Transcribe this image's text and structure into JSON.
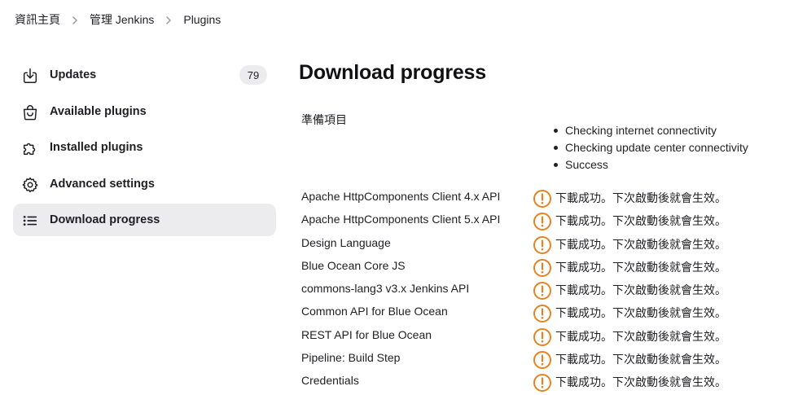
{
  "breadcrumb": {
    "items": [
      "資訊主頁",
      "管理 Jenkins",
      "Plugins"
    ]
  },
  "sidebar": {
    "items": [
      {
        "label": "Updates",
        "icon": "download-icon",
        "badge": "79"
      },
      {
        "label": "Available plugins",
        "icon": "shopping-bag-icon"
      },
      {
        "label": "Installed plugins",
        "icon": "puzzle-icon"
      },
      {
        "label": "Advanced settings",
        "icon": "gear-icon"
      },
      {
        "label": "Download progress",
        "icon": "list-icon",
        "active": true
      }
    ]
  },
  "main": {
    "title": "Download progress",
    "preparation": {
      "label": "準備項目",
      "checks": [
        "Checking internet connectivity",
        "Checking update center connectivity",
        "Success"
      ]
    },
    "status_icon": "warning-circle-icon",
    "status_color": "#e8821e",
    "plugins": [
      {
        "name": "Apache HttpComponents Client 4.x API",
        "status": "下載成功。下次啟動後就會生效。"
      },
      {
        "name": "Apache HttpComponents Client 5.x API",
        "status": "下載成功。下次啟動後就會生效。"
      },
      {
        "name": "Design Language",
        "status": "下載成功。下次啟動後就會生效。"
      },
      {
        "name": "Blue Ocean Core JS",
        "status": "下載成功。下次啟動後就會生效。"
      },
      {
        "name": "commons-lang3 v3.x Jenkins API",
        "status": "下載成功。下次啟動後就會生效。"
      },
      {
        "name": "Common API for Blue Ocean",
        "status": "下載成功。下次啟動後就會生效。"
      },
      {
        "name": "REST API for Blue Ocean",
        "status": "下載成功。下次啟動後就會生效。"
      },
      {
        "name": "Pipeline: Build Step",
        "status": "下載成功。下次啟動後就會生效。"
      },
      {
        "name": "Credentials",
        "status": "下載成功。下次啟動後就會生效。"
      }
    ]
  }
}
